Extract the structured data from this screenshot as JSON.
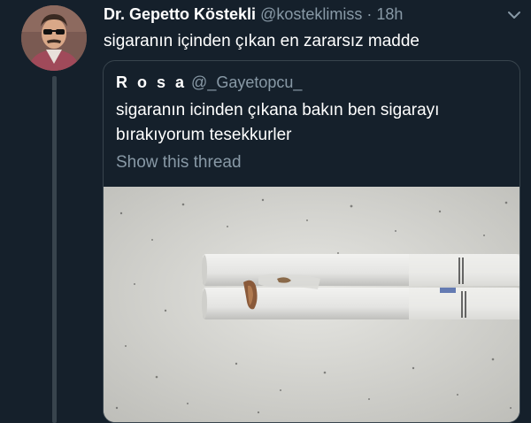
{
  "tweet": {
    "display_name": "Dr. Gepetto Köstekli",
    "handle": "@kosteklimiss",
    "separator": "·",
    "time": "18h",
    "text": "sigaranın içinden çıkan en zararsız madde",
    "avatar_icon": "profile-photo-avatar",
    "menu_icon": "chevron-down-icon"
  },
  "quote": {
    "display_name": "R o s a",
    "handle": "@_Gayetopcu_",
    "text": "sigaranın icinden çıkana bakın ben sigarayı bırakıyorum tesekkurler",
    "show_thread": "Show this thread"
  },
  "colors": {
    "background": "#15202b",
    "secondary_text": "#8899a6",
    "border": "#38444d"
  }
}
